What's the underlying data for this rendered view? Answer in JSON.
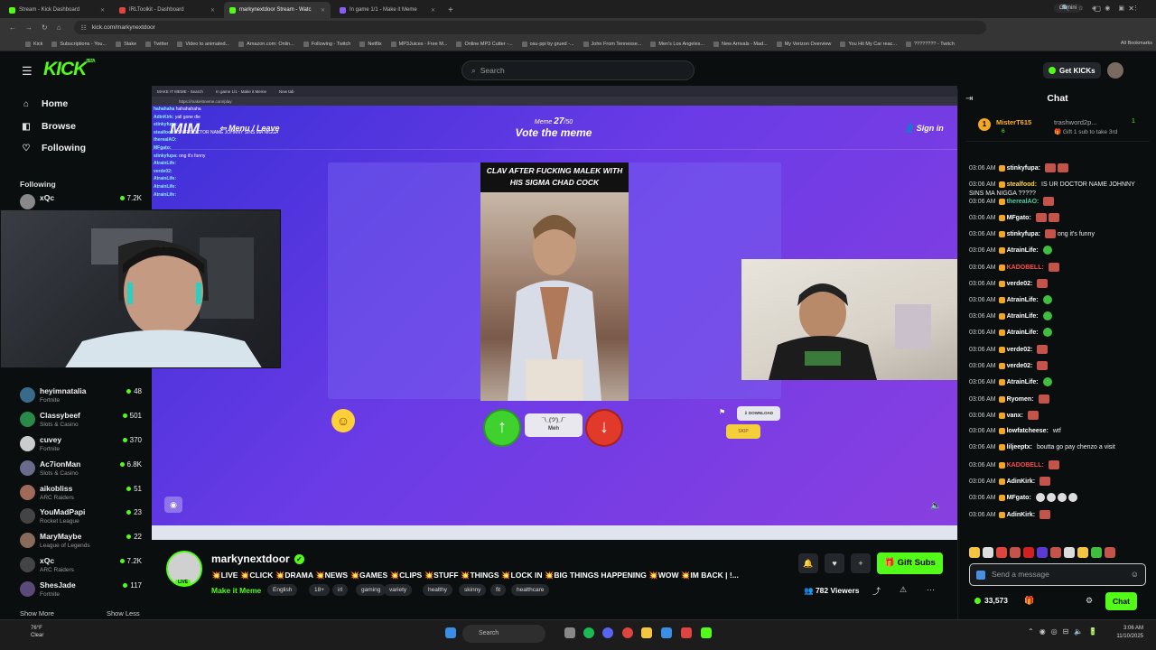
{
  "browser": {
    "tabs": [
      {
        "title": "Stream - Kick Dashboard",
        "color": "#53fc18",
        "active": false
      },
      {
        "title": "IRLToolkit - Dashboard",
        "color": "#e0443e",
        "active": false
      },
      {
        "title": "markynextdoor Stream - Watc",
        "color": "#53fc18",
        "active": true
      },
      {
        "title": "In game 1/1 - Make it Meme",
        "color": "#8a5cf6",
        "active": false
      }
    ],
    "gemini_label": "Gemini",
    "url": "kick.com/markynextdoor",
    "bookmarks": [
      "Kick",
      "Subscriptions - You...",
      "Stake",
      "Twitter",
      "Video to animated...",
      "Amazon.com: Onlin...",
      "Following - Twitch",
      "Netflix",
      "MP3Juices - Free M...",
      "Online MP3 Cutter -...",
      "osu-ppi by grued -...",
      "John From Tennesse...",
      "Men's Los Angeles...",
      "New Arrivals - Mad...",
      "My Verizon Overview",
      "You Hit My Car reac...",
      "???????? - Twitch"
    ],
    "all_bookmarks": "All Bookmarks"
  },
  "header": {
    "logo": "KICK",
    "logo_beta": "BETA",
    "search_placeholder": "Search",
    "get_kicks": "Get KICKs"
  },
  "sidebar": {
    "nav": [
      {
        "label": "Home",
        "icon": "home-icon"
      },
      {
        "label": "Browse",
        "icon": "browse-icon"
      },
      {
        "label": "Following",
        "icon": "heart-icon"
      }
    ],
    "following_heading": "Following",
    "channels": [
      {
        "name": "xQc",
        "game": "",
        "viewers": "7.2K",
        "color": "#888"
      },
      {
        "name": "heyimnatalia",
        "game": "Fortnite",
        "viewers": "48",
        "color": "#3a6a8a"
      },
      {
        "name": "Classybeef",
        "game": "Slots & Casino",
        "viewers": "501",
        "color": "#2a8a4a"
      },
      {
        "name": "cuvey",
        "game": "Fortnite",
        "viewers": "370",
        "color": "#ccc"
      },
      {
        "name": "Ac7ionMan",
        "game": "Slots & Casino",
        "viewers": "6.8K",
        "color": "#6a6a8a"
      },
      {
        "name": "aikobliss",
        "game": "ARC Raiders",
        "viewers": "51",
        "color": "#a06a5a"
      },
      {
        "name": "YouMadPapi",
        "game": "Rocket League",
        "viewers": "23",
        "color": "#444"
      },
      {
        "name": "MaryMaybe",
        "game": "League of Legends",
        "viewers": "22",
        "color": "#8a6a5a"
      },
      {
        "name": "xQc",
        "game": "ARC Raiders",
        "viewers": "7.2K",
        "color": "#444"
      },
      {
        "name": "ShesJade",
        "game": "Fortnite",
        "viewers": "117",
        "color": "#5a4a7a"
      }
    ],
    "show_more": "Show More",
    "show_less": "Show Less"
  },
  "stream_overlay": {
    "game_tabs": [
      "MAKE IT MEME - Search",
      "In game 1/1 - Make it Meme",
      "New tab"
    ],
    "game_url": "https://makeitmeme.com/play",
    "menu_leave": "Menu / Leave",
    "meme_label": "Meme",
    "meme_current": "27",
    "meme_total": "50",
    "vote_title": "Vote the meme",
    "sign_in": "Sign in",
    "meme_caption": "CLAV AFTER FUCKING MALEK WITH HIS SIGMA CHAD COCK",
    "meh_label": "Meh",
    "meh_face": "¯\\_(ツ)_/¯",
    "download_label": "DOWNLOAD",
    "skip_label": "SKIP",
    "overlay_chat": [
      {
        "user": "hahahaha",
        "text": "hahahahaha"
      },
      {
        "user": "AdinKirk:",
        "text": "yall gone die"
      },
      {
        "user": "stinkyfupa:",
        "text": ""
      },
      {
        "user": "stealfood:",
        "text": "IS UR DOCTOR NAME JOHNNY SINS MA NIGGA ?????"
      },
      {
        "user": "therealAO:",
        "text": ""
      },
      {
        "user": "MFgato:",
        "text": ""
      },
      {
        "user": "stinkyfupa:",
        "text": "ong it's funny"
      },
      {
        "user": "AtrainLife:",
        "text": ""
      },
      {
        "user": "verde02:",
        "text": ""
      },
      {
        "user": "AtrainLife:",
        "text": ""
      },
      {
        "user": "AtrainLife:",
        "text": ""
      },
      {
        "user": "AtrainLife:",
        "text": ""
      }
    ]
  },
  "channel": {
    "name": "markynextdoor",
    "live_badge": "LIVE",
    "title": "💥LIVE 💥CLICK 💥DRAMA 💥NEWS 💥GAMES 💥CLIPS 💥STUFF 💥THINGS 💥LOCK IN 💥BIG THINGS HAPPENING 💥WOW 💥IM BACK | !...",
    "category": "Make it Meme",
    "tags": [
      "English",
      "18+",
      "irl",
      "gaming",
      "variety",
      "healthy",
      "skinny",
      "fit",
      "healthcare"
    ],
    "gift_subs": "Gift Subs",
    "viewers": "782 Viewers"
  },
  "chat": {
    "title": "Chat",
    "pinned": {
      "rank": "1",
      "user": "MisterT615",
      "user2": "trashword2p...",
      "count": "1",
      "count2": "6",
      "sub_text": "Gift 1 sub to take 3rd"
    },
    "messages": [
      {
        "time": "03:06 AM",
        "user": "stinkyfupa:",
        "color": "#ffffff",
        "text": "",
        "emotes": "rr"
      },
      {
        "time": "03:06 AM",
        "user": "stealfood:",
        "color": "#ffd23f",
        "text": "IS UR DOCTOR NAME JOHNNY SINS MA NIGGA ?????",
        "emotes": ""
      },
      {
        "time": "03:06 AM",
        "user": "therealAO:",
        "color": "#4dd0a0",
        "text": "",
        "emotes": "r"
      },
      {
        "time": "03:06 AM",
        "user": "MFgato:",
        "color": "#ffffff",
        "text": "",
        "emotes": "rr"
      },
      {
        "time": "03:06 AM",
        "user": "stinkyfupa:",
        "color": "#ffffff",
        "text": "ong it's funny",
        "emotes": "r"
      },
      {
        "time": "03:06 AM",
        "user": "AtrainLife:",
        "color": "#ffffff",
        "text": "",
        "emotes": "g"
      },
      {
        "time": "03:06 AM",
        "user": "KADOBELL:",
        "color": "#ff4d4d",
        "text": "",
        "emotes": "r"
      },
      {
        "time": "03:06 AM",
        "user": "verde02:",
        "color": "#ffffff",
        "text": "",
        "emotes": "r"
      },
      {
        "time": "03:06 AM",
        "user": "AtrainLife:",
        "color": "#ffffff",
        "text": "",
        "emotes": "g"
      },
      {
        "time": "03:06 AM",
        "user": "AtrainLife:",
        "color": "#ffffff",
        "text": "",
        "emotes": "g"
      },
      {
        "time": "03:06 AM",
        "user": "AtrainLife:",
        "color": "#ffffff",
        "text": "",
        "emotes": "g"
      },
      {
        "time": "03:06 AM",
        "user": "verde02:",
        "color": "#ffffff",
        "text": "",
        "emotes": "r"
      },
      {
        "time": "03:06 AM",
        "user": "verde02:",
        "color": "#ffffff",
        "text": "",
        "emotes": "r"
      },
      {
        "time": "03:06 AM",
        "user": "AtrainLife:",
        "color": "#ffffff",
        "text": "",
        "emotes": "g"
      },
      {
        "time": "03:06 AM",
        "user": "Ryomen:",
        "color": "#ffffff",
        "text": "",
        "emotes": "r"
      },
      {
        "time": "03:06 AM",
        "user": "vanx:",
        "color": "#ffffff",
        "text": "",
        "emotes": "r"
      },
      {
        "time": "03:06 AM",
        "user": "lowfatcheese:",
        "color": "#ffffff",
        "text": "wtf",
        "emotes": ""
      },
      {
        "time": "03:06 AM",
        "user": "liljeeptx:",
        "color": "#ffffff",
        "text": "boutta go pay chenzo a visit",
        "emotes": ""
      },
      {
        "time": "03:06 AM",
        "user": "KADOBELL:",
        "color": "#ff4d4d",
        "text": "",
        "emotes": "r"
      },
      {
        "time": "03:06 AM",
        "user": "AdinKirk:",
        "color": "#ffffff",
        "text": "",
        "emotes": "r"
      },
      {
        "time": "03:06 AM",
        "user": "MFgato:",
        "color": "#ffffff",
        "text": "",
        "emotes": "wwww"
      },
      {
        "time": "03:06 AM",
        "user": "AdinKirk:",
        "color": "#ffffff",
        "text": "",
        "emotes": "r"
      }
    ],
    "input_placeholder": "Send a message",
    "kicks_balance": "33,573",
    "chat_button": "Chat"
  },
  "taskbar": {
    "weather_temp": "76°F",
    "weather_desc": "Clear",
    "search_label": "Search",
    "time": "3:06 AM",
    "date": "11/10/2025"
  }
}
